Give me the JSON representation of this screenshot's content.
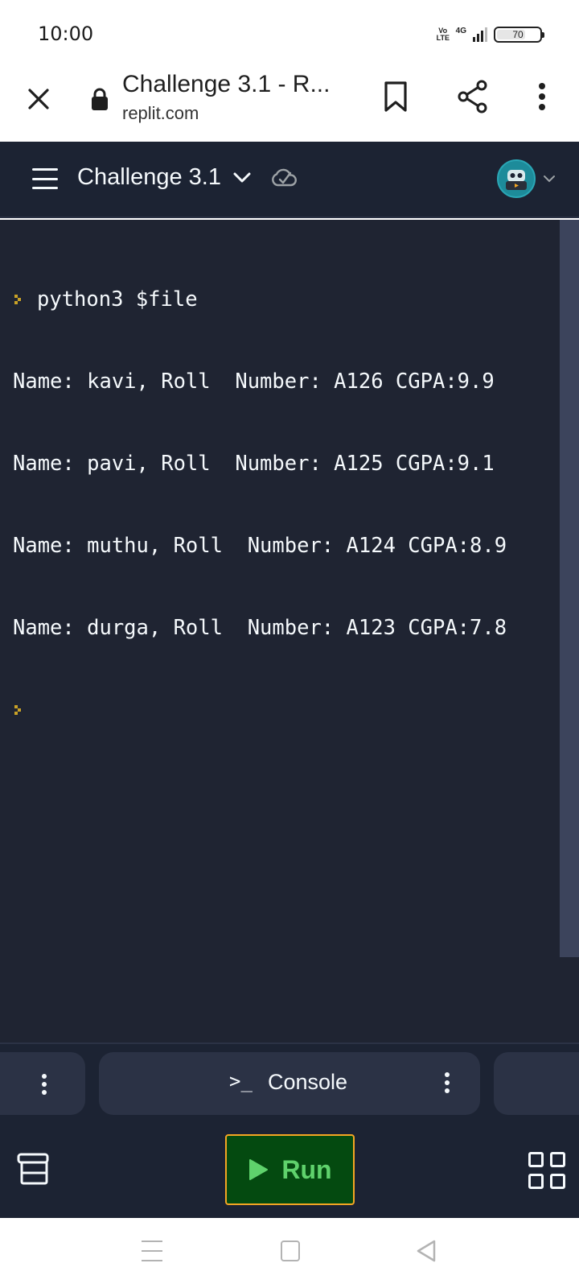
{
  "status_bar": {
    "time": "10:00",
    "volte": "Vo LTE",
    "network": "4G",
    "battery": "70",
    "battery_level_percent": 70
  },
  "browser": {
    "tab_title": "Challenge 3.1 - R...",
    "url": "replit.com",
    "icons": [
      "close-icon",
      "lock-icon",
      "bookmark-icon",
      "share-icon",
      "more-vert-icon"
    ]
  },
  "app_header": {
    "project_name": "Challenge 3.1",
    "icons": [
      "menu-icon",
      "chevron-down-icon",
      "cloud-check-icon",
      "avatar",
      "chevron-down-icon"
    ]
  },
  "console": {
    "command": "python3 $file",
    "output_lines": [
      "Name: kavi, Roll  Number: A126 CGPA:9.9",
      "Name: pavi, Roll  Number: A125 CGPA:9.1",
      "Name: muthu, Roll  Number: A124 CGPA:8.9",
      "Name: durga, Roll  Number: A123 CGPA:7.8"
    ]
  },
  "tabs": {
    "console_icon": ">_",
    "console_label": "Console"
  },
  "toolbar": {
    "run_label": "Run",
    "accent_color": "#f5a623",
    "run_color": "#5fd26c"
  }
}
